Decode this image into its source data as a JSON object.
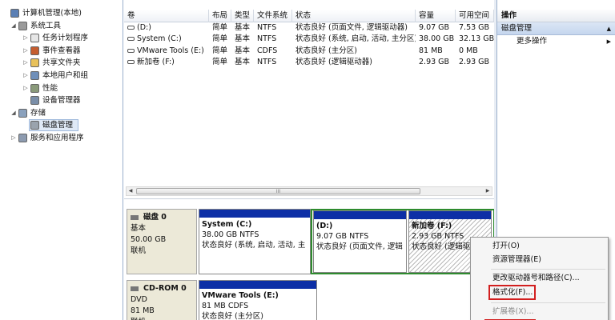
{
  "tree": [
    {
      "label": "计算机管理(本地)",
      "icon": "computer-icon",
      "exp": "",
      "depth": 0,
      "color": "#5b7fb4"
    },
    {
      "label": "系统工具",
      "icon": "tools-icon",
      "exp": "◢",
      "depth": 1,
      "color": "#9a9a9a"
    },
    {
      "label": "任务计划程序",
      "icon": "clock-icon",
      "exp": "▷",
      "depth": 2,
      "color": "#e6e6e6"
    },
    {
      "label": "事件查看器",
      "icon": "event-viewer-icon",
      "exp": "▷",
      "depth": 2,
      "color": "#c55d2f"
    },
    {
      "label": "共享文件夹",
      "icon": "shared-folder-icon",
      "exp": "▷",
      "depth": 2,
      "color": "#e8c15a"
    },
    {
      "label": "本地用户和组",
      "icon": "users-icon",
      "exp": "▷",
      "depth": 2,
      "color": "#6f8fb9"
    },
    {
      "label": "性能",
      "icon": "performance-icon",
      "exp": "▷",
      "depth": 2,
      "color": "#8a9a7a"
    },
    {
      "label": "设备管理器",
      "icon": "device-manager-icon",
      "exp": "",
      "depth": 2,
      "color": "#7a8ea8"
    },
    {
      "label": "存储",
      "icon": "storage-icon",
      "exp": "◢",
      "depth": 1,
      "color": "#8aa1bd"
    },
    {
      "label": "磁盘管理",
      "icon": "disk-management-icon",
      "exp": "",
      "depth": 2,
      "color": "#9aa3ad",
      "selected": true
    },
    {
      "label": "服务和应用程序",
      "icon": "services-icon",
      "exp": "▷",
      "depth": 1,
      "color": "#8d9bb0"
    }
  ],
  "table": {
    "headers": [
      "卷",
      "布局",
      "类型",
      "文件系统",
      "状态",
      "容量",
      "可用空间"
    ],
    "rows": [
      [
        "(D:)",
        "简单",
        "基本",
        "NTFS",
        "状态良好 (页面文件, 逻辑驱动器)",
        "9.07 GB",
        "7.53 GB"
      ],
      [
        "System (C:)",
        "简单",
        "基本",
        "NTFS",
        "状态良好 (系统, 启动, 活动, 主分区)",
        "38.00 GB",
        "32.13 GB"
      ],
      [
        "VMware Tools (E:)",
        "简单",
        "基本",
        "CDFS",
        "状态良好 (主分区)",
        "81 MB",
        "0 MB"
      ],
      [
        "新加卷 (F:)",
        "简单",
        "基本",
        "NTFS",
        "状态良好 (逻辑驱动器)",
        "2.93 GB",
        "2.93 GB"
      ]
    ],
    "scroll_mark": "III"
  },
  "disks": {
    "disk0": {
      "name": "磁盘 0",
      "type": "基本",
      "size": "50.00 GB",
      "status": "联机"
    },
    "cdrom0": {
      "name": "CD-ROM 0",
      "type": "DVD",
      "size": "81 MB",
      "status": "联机"
    },
    "partitions": [
      {
        "title": "System (C:)",
        "size": "38.00 GB NTFS",
        "status": "状态良好 (系统, 启动, 活动, 主"
      },
      {
        "title": "(D:)",
        "size": "9.07 GB NTFS",
        "status": "状态良好 (页面文件, 逻辑"
      },
      {
        "title": "新加卷 (F:)",
        "size": "2.93 GB NTFS",
        "status": "状态良好 (逻辑驱"
      },
      {
        "title": "VMware Tools (E:)",
        "size": "81 MB CDFS",
        "status": "状态良好 (主分区)"
      }
    ]
  },
  "actions": {
    "header": "操作",
    "section": "磁盘管理",
    "more": "更多操作"
  },
  "menu": {
    "items": [
      "打开(O)",
      "资源管理器(E)",
      "更改驱动器号和路径(C)...",
      "格式化(F)...",
      "扩展卷(X)..."
    ]
  },
  "colors": {
    "primary_bar": "#0d2fa6",
    "selection": "#cfe3f8",
    "highlight_box": "#d21f1f"
  }
}
